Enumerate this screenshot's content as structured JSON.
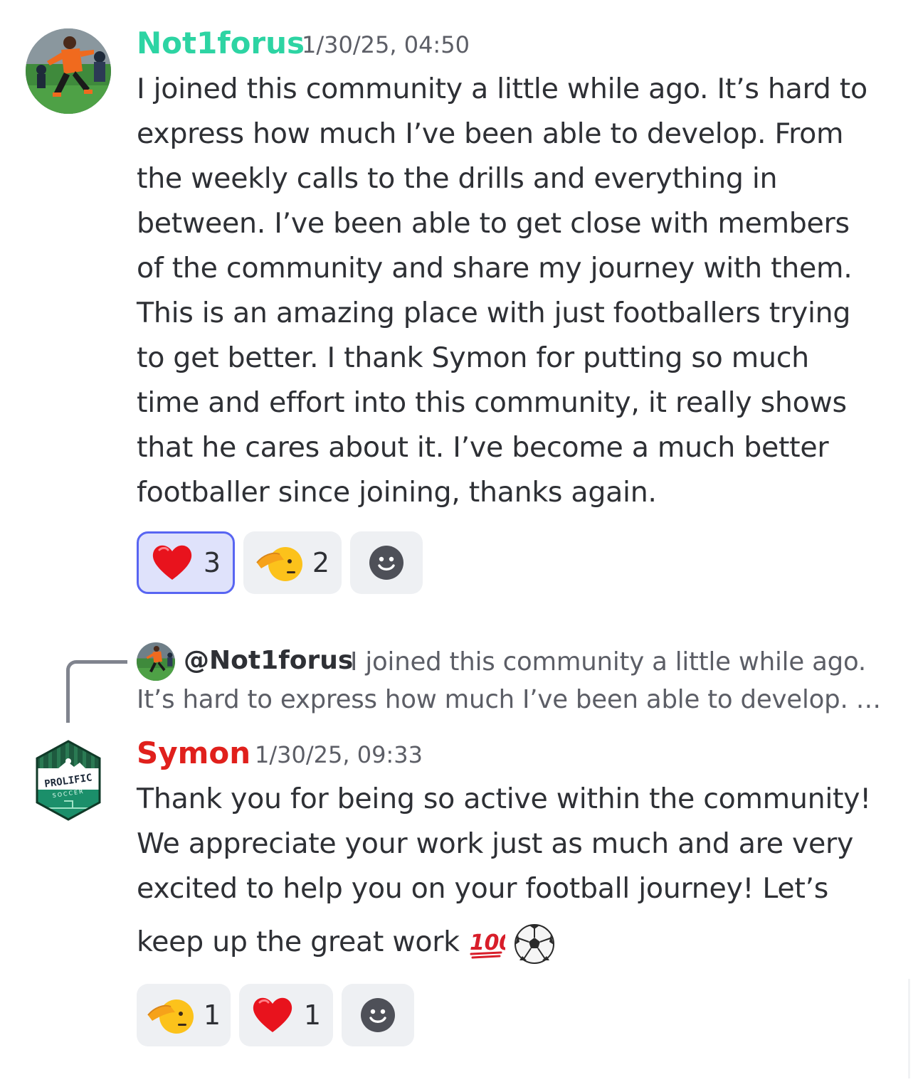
{
  "message1": {
    "author": "Not1forus",
    "timestamp": "1/30/25, 04:50",
    "lines": [
      "I joined this community a little while ago. It’s hard to",
      "express how much I’ve been able to develop. From",
      "the weekly calls to the drills and everything in",
      "between. I’ve been able to get close with members",
      "of the community and share my journey with them.",
      "This is an amazing place with just footballers trying",
      "to get better. I thank Symon for putting so much",
      "time and effort into this community, it really shows",
      "that he cares about it. I’ve become a much better",
      "footballer since joining, thanks again."
    ],
    "reactions": [
      {
        "emoji": "heart-emoji",
        "count": "3",
        "active": true
      },
      {
        "emoji": "saluting-face-emoji",
        "count": "2",
        "active": false
      },
      {
        "emoji": "add-reaction-icon",
        "count": "",
        "active": false
      }
    ]
  },
  "reply": {
    "mention": "@Not1forus",
    "preview_line1": "I joined this community a little while ago.",
    "preview_line2": "It’s hard to express how much I’ve been able to develop. …"
  },
  "message2": {
    "author": "Symon",
    "timestamp": "1/30/25, 09:33",
    "lines": [
      "Thank you for being so active within the community!",
      "We appreciate your work just as much and are very",
      "excited to help you on your football journey! Let’s"
    ],
    "last_line": "keep up the great work",
    "inline_emojis": [
      "hundred-points-emoji",
      "soccer-ball-emoji"
    ],
    "reactions": [
      {
        "emoji": "saluting-face-emoji",
        "count": "1",
        "active": false
      },
      {
        "emoji": "heart-emoji",
        "count": "1",
        "active": false
      },
      {
        "emoji": "add-reaction-icon",
        "count": "",
        "active": false
      }
    ],
    "avatar_logo_text": "PROLIFIC SOCCER"
  },
  "colors": {
    "author1": "#2dd4a3",
    "author2": "#e0201c",
    "reaction_active_bg": "#dfe2fb",
    "reaction_active_border": "#5865f2",
    "reaction_bg": "#eef0f3"
  }
}
